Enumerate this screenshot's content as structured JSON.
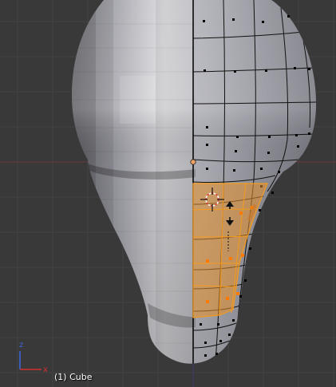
{
  "viewport": {
    "object_label": "(1) Cube",
    "axis_labels": {
      "z": "z",
      "x": "x"
    },
    "colors": {
      "background": "#393939",
      "grid_line": "#444444",
      "x_axis_line": "#6b3b3b",
      "y_axis_line": "#3b3b6b",
      "mesh_edge": "#111111",
      "selected_face": "#f0a030",
      "selected_edge": "#f39a1e",
      "axis_x": "#d32f2f",
      "axis_z": "#3a66d6",
      "cursor_red": "#e04040"
    },
    "icons": [
      "3d-cursor-icon",
      "axis-gizmo-icon",
      "object-origin-icon",
      "transform-arrows-icon"
    ]
  }
}
